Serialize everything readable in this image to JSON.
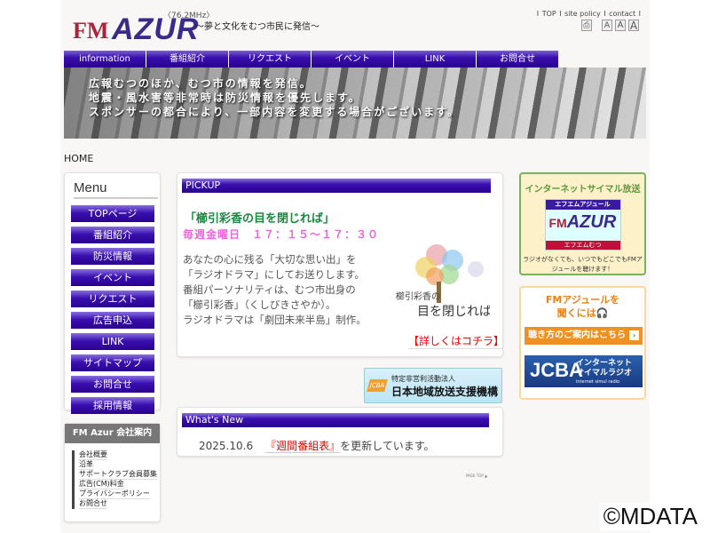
{
  "header": {
    "logo_fm": "FM",
    "logo_azur": "AZUR",
    "logo_freq": "〈76.2MHz〉",
    "tagline": "～夢と文化をむつ市民に発信～",
    "top_links": [
      "TOP",
      "site policy",
      "contact"
    ],
    "tools": [
      "print-icon",
      "A",
      "A",
      "A"
    ]
  },
  "nav": [
    "information",
    "番組紹介",
    "リクエスト",
    "イベント",
    "LINK",
    "お問合せ"
  ],
  "banner": [
    "広報むつのほか、むつ市の情報を発信。",
    "地震・風水害等非常時は防災情報を優先します。",
    "スポンサーの都合により、一部内容を変更する場合がございます。"
  ],
  "breadcrumb": "HOME",
  "menu": {
    "title": "Menu",
    "items": [
      "TOPページ",
      "番組紹介",
      "防災情報",
      "イベント",
      "リクエスト",
      "広告申込",
      "LINK",
      "サイトマップ",
      "お問合せ",
      "採用情報"
    ]
  },
  "corp": {
    "title": "FM Azur 会社案内",
    "items": [
      "会社概要",
      "沿革",
      "サポートクラブ会員募集",
      "広告(CM)料金",
      "プライバシーポリシー",
      "お問合せ"
    ]
  },
  "pickup": {
    "heading": "PICKUP",
    "title": "「櫛引彩香の目を閉じれば」",
    "time": "毎週金曜日　１７：１５〜１７：３０",
    "body": [
      "あなたの心に残る「大切な思い出」を",
      "「ラジオドラマ」にしてお送りします。",
      "番組パーソナリティは、むつ市出身の",
      "「櫛引彩香」（くしびきさやか）。",
      "ラジオドラマは「劇団未来半島」制作。"
    ],
    "image_text1": "櫛引彩香の",
    "image_text2": "目を閉じれば",
    "more": "【詳しくはコチラ】"
  },
  "jcba_ad": {
    "line1": "特定非営利活動法人",
    "line2": "日本地域放送支援機構"
  },
  "news": {
    "heading": "What's New",
    "date": "2025.10.6",
    "link": "『週間番組表』",
    "text": "を更新しています。"
  },
  "page_top": "PAGE TOP ▲",
  "simul": {
    "heading": "インターネットサイマル放送",
    "logo_top": "エフエムアジュール",
    "logo_bottom": "エフエムむつ",
    "desc": "ラジオがなくても、いつでもどこでもFMアジュールを聴けます！"
  },
  "listen": {
    "heading1": "FMアジュールを",
    "heading2": "聞くには🎧",
    "how": "聴き方のご案内はこちら",
    "jcba_logo": "JCBA",
    "jcba_l1": "インターネット",
    "jcba_l2": "サイマルラジオ",
    "jcba_l3": "internet simul radio"
  },
  "watermark": "©MDATA"
}
